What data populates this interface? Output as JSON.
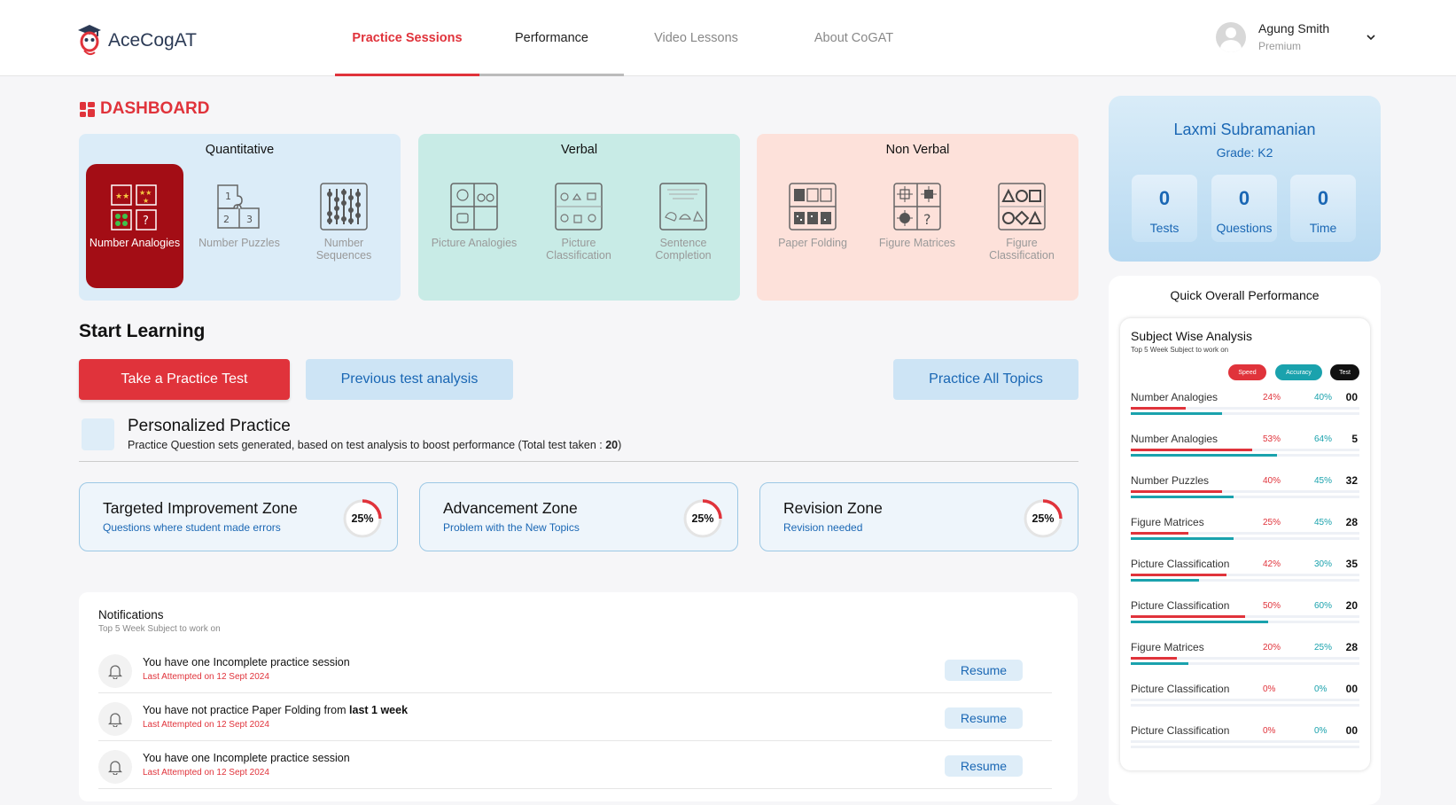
{
  "app": {
    "name": "AceCogAT"
  },
  "nav": {
    "tabs": [
      {
        "label": "Practice Sessions"
      },
      {
        "label": "Performance"
      },
      {
        "label": "Video Lessons"
      },
      {
        "label": "About CoGAT"
      }
    ]
  },
  "user": {
    "name": "Agung Smith",
    "plan": "Premium"
  },
  "dashboard": {
    "title": "DASHBOARD"
  },
  "categories": [
    {
      "title": "Quantitative",
      "color": "#dbecf8",
      "items": [
        {
          "label": "Number Analogies",
          "icon": "number-analogies-icon"
        },
        {
          "label": "Number Puzzles",
          "icon": "number-puzzles-icon"
        },
        {
          "label": "Number Sequences",
          "icon": "number-sequences-icon"
        }
      ]
    },
    {
      "title": "Verbal",
      "color": "#c8ebe6",
      "items": [
        {
          "label": "Picture Analogies",
          "icon": "picture-analogies-icon"
        },
        {
          "label": "Picture Classification",
          "icon": "picture-classification-icon"
        },
        {
          "label": "Sentence Completion",
          "icon": "sentence-completion-icon"
        }
      ]
    },
    {
      "title": "Non Verbal",
      "color": "#fde1da",
      "items": [
        {
          "label": "Paper Folding",
          "icon": "paper-folding-icon"
        },
        {
          "label": "Figure Matrices",
          "icon": "figure-matrices-icon"
        },
        {
          "label": "Figure Classification",
          "icon": "figure-classification-icon"
        }
      ]
    }
  ],
  "start_learning": {
    "title": "Start Learning",
    "take_test": "Take a Practice Test",
    "previous_analysis": "Previous test analysis",
    "practice_all": "Practice All Topics"
  },
  "personalized": {
    "title": "Personalized Practice",
    "subtitle": "Practice Question sets generated, based on test analysis to boost performance (Total test taken : ",
    "total": "20",
    "subtitle_end": ")"
  },
  "zones": [
    {
      "title": "Targeted Improvement Zone",
      "subtitle": "Questions where student made errors",
      "percent_label": "25%",
      "percent": 25
    },
    {
      "title": "Advancement Zone",
      "subtitle": "Problem with the New Topics",
      "percent_label": "25%",
      "percent": 25
    },
    {
      "title": "Revision Zone",
      "subtitle": "Revision needed",
      "percent_label": "25%",
      "percent": 25
    }
  ],
  "notifications": {
    "title": "Notifications",
    "subtitle": "Top 5 Week Subject to work on",
    "resume_label": "Resume",
    "items": [
      {
        "message": "You have one Incomplete practice session",
        "bold": "",
        "date": "Last Attempted on 12 Sept 2024"
      },
      {
        "message": "You have not practice Paper Folding from ",
        "bold": "last 1 week",
        "date": "Last Attempted on 12 Sept 2024"
      },
      {
        "message": "You have one Incomplete practice session",
        "bold": "",
        "date": "Last Attempted on 12 Sept 2024"
      }
    ]
  },
  "profile": {
    "name": "Laxmi Subramanian",
    "grade": "Grade: K2",
    "stats": [
      {
        "value": "0",
        "label": "Tests"
      },
      {
        "value": "0",
        "label": "Questions"
      },
      {
        "value": "0",
        "label": "Time"
      }
    ]
  },
  "quick_performance": {
    "title": "Quick Overall Performance",
    "card_title": "Subject Wise Analysis",
    "card_subtitle": "Top 5 Week Subject to work on",
    "legend": {
      "speed": "Speed",
      "accuracy": "Accuracy",
      "test": "Test"
    },
    "colors": {
      "speed": "#e0333b",
      "accuracy": "#1aa2ad",
      "test": "#111111"
    },
    "rows": [
      {
        "subject": "Number Analogies",
        "speed_label": "24%",
        "speed": 24,
        "accuracy_label": "40%",
        "accuracy": 40,
        "tests": "00"
      },
      {
        "subject": "Number Analogies",
        "speed_label": "53%",
        "speed": 53,
        "accuracy_label": "64%",
        "accuracy": 64,
        "tests": "5"
      },
      {
        "subject": "Number Puzzles",
        "speed_label": "40%",
        "speed": 40,
        "accuracy_label": "45%",
        "accuracy": 45,
        "tests": "32"
      },
      {
        "subject": "Figure Matrices",
        "speed_label": "25%",
        "speed": 25,
        "accuracy_label": "45%",
        "accuracy": 45,
        "tests": "28"
      },
      {
        "subject": "Picture Classification",
        "speed_label": "42%",
        "speed": 42,
        "accuracy_label": "30%",
        "accuracy": 30,
        "tests": "35"
      },
      {
        "subject": "Picture Classification",
        "speed_label": "50%",
        "speed": 50,
        "accuracy_label": "60%",
        "accuracy": 60,
        "tests": "20"
      },
      {
        "subject": "Figure Matrices",
        "speed_label": "20%",
        "speed": 20,
        "accuracy_label": "25%",
        "accuracy": 25,
        "tests": "28"
      },
      {
        "subject": "Picture Classification",
        "speed_label": "0%",
        "speed": 0,
        "accuracy_label": "0%",
        "accuracy": 0,
        "tests": "00"
      },
      {
        "subject": "Picture Classification",
        "speed_label": "0%",
        "speed": 0,
        "accuracy_label": "0%",
        "accuracy": 0,
        "tests": "00"
      }
    ]
  }
}
